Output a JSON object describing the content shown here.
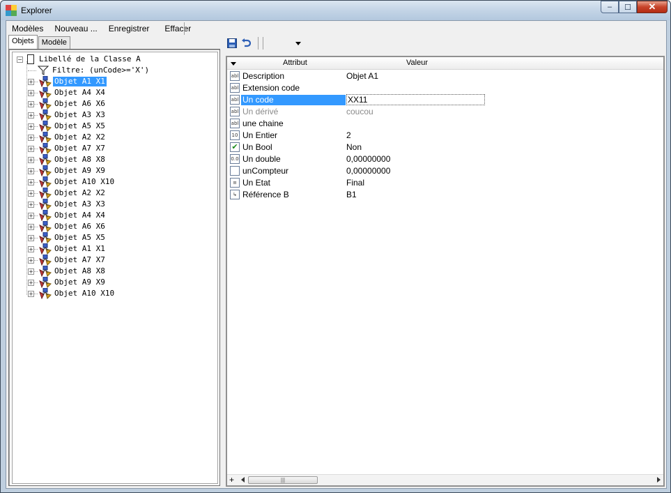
{
  "window": {
    "title": "Explorer",
    "buttons": {
      "minimize": "–",
      "maximize": "☐",
      "close": "✕"
    }
  },
  "menu": [
    "Modèles",
    "Nouveau ...",
    "Enregistrer",
    "Effacer"
  ],
  "tabs": [
    {
      "label": "Objets",
      "active": true
    },
    {
      "label": "Modèle",
      "active": false
    }
  ],
  "tree": {
    "root": "Libellé de la Classe A",
    "filter": "Filtre: (unCode>='X')",
    "selected_index": 0,
    "items": [
      "Objet A1 X1",
      "Objet A4 X4",
      "Objet A6 X6",
      "Objet A3 X3",
      "Objet A5 X5",
      "Objet A2 X2",
      "Objet A7 X7",
      "Objet A8 X8",
      "Objet A9 X9",
      "Objet A10 X10",
      "Objet A2 X2",
      "Objet A3 X3",
      "Objet A4 X4",
      "Objet A6 X6",
      "Objet A5 X5",
      "Objet A1 X1",
      "Objet A7 X7",
      "Objet A8 X8",
      "Objet A9 X9",
      "Objet A10 X10"
    ]
  },
  "grid": {
    "headers": {
      "attribute": "Attribut",
      "value": "Valeur"
    },
    "rows": [
      {
        "name": "Description",
        "value": "Objet A1",
        "icon": "abl",
        "state": "normal"
      },
      {
        "name": "Extension code",
        "value": "",
        "icon": "abl",
        "state": "normal"
      },
      {
        "name": "Un code",
        "value": "XX11",
        "icon": "abl",
        "state": "selected"
      },
      {
        "name": "Un dérivé",
        "value": "coucou",
        "icon": "abl",
        "state": "disabled"
      },
      {
        "name": "une chaine",
        "value": "",
        "icon": "abl",
        "state": "normal"
      },
      {
        "name": "Un Entier",
        "value": "2",
        "icon": "10",
        "state": "normal"
      },
      {
        "name": "Un Bool",
        "value": "Non",
        "icon": "check",
        "state": "normal"
      },
      {
        "name": "Un double",
        "value": "0,00000000",
        "icon": "0.0",
        "state": "normal"
      },
      {
        "name": "unCompteur",
        "value": "0,00000000",
        "icon": "blank",
        "state": "normal"
      },
      {
        "name": "Un Etat",
        "value": "Final",
        "icon": "enum",
        "state": "normal"
      },
      {
        "name": "Référence B",
        "value": "B1",
        "icon": "ref",
        "state": "normal"
      }
    ]
  },
  "colors": {
    "selection": "#3399ff",
    "frame": "#bfcfdf"
  }
}
